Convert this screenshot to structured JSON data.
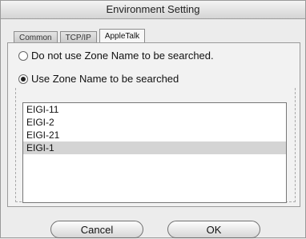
{
  "window": {
    "title": "Environment Setting"
  },
  "tabs": [
    "Common",
    "TCP/IP",
    "AppleTalk"
  ],
  "options": {
    "no_zone_label": "Do not use Zone Name to be searched.",
    "use_zone_label": "Use Zone Name to be searched"
  },
  "zones": [
    "EIGI-11",
    "EIGI-2",
    "EIGI-21",
    "EIGI-1"
  ],
  "selected_zone": "EIGI-1",
  "buttons": {
    "cancel": "Cancel",
    "ok": "OK"
  }
}
